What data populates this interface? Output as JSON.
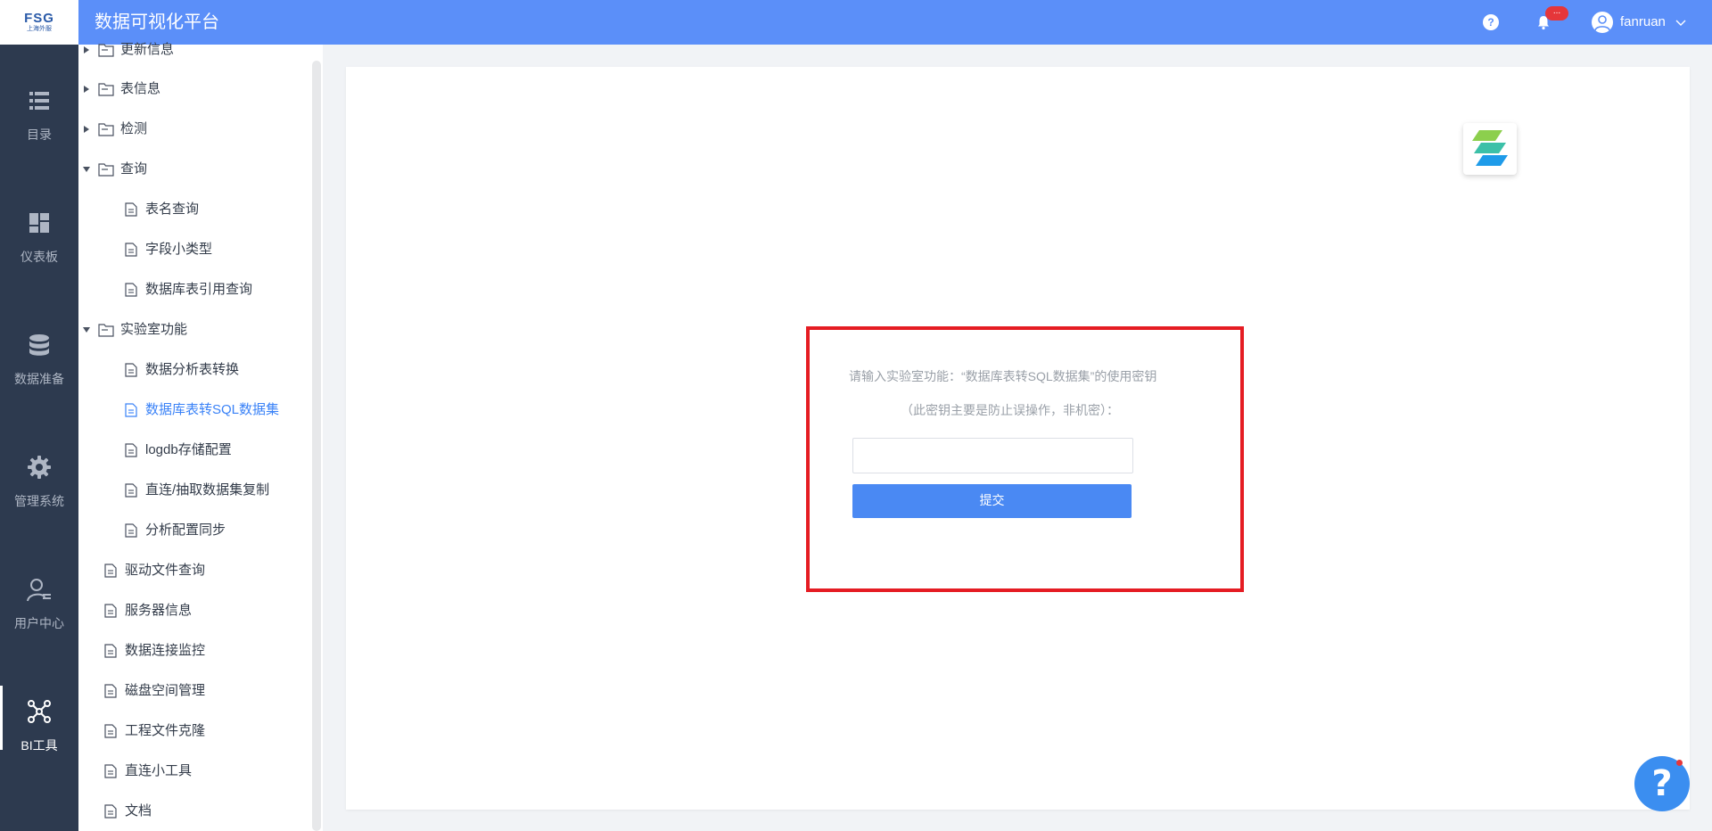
{
  "header": {
    "logo_top": "FSG",
    "logo_bottom": "上海外服",
    "title": "数据可视化平台",
    "help_glyph": "?",
    "notification_badge": "...",
    "username": "fanruan"
  },
  "leftnav": {
    "items": [
      {
        "label": "目录",
        "icon": "list-icon",
        "active": false
      },
      {
        "label": "仪表板",
        "icon": "dashboard-icon",
        "active": false
      },
      {
        "label": "数据准备",
        "icon": "database-icon",
        "active": false
      },
      {
        "label": "管理系统",
        "icon": "gear-icon",
        "active": false
      },
      {
        "label": "用户中心",
        "icon": "user-icon",
        "active": false
      },
      {
        "label": "BI工具",
        "icon": "network-icon",
        "active": true
      }
    ]
  },
  "tree": {
    "items": [
      {
        "label": "更新信息",
        "type": "folder",
        "state": "collapsed"
      },
      {
        "label": "表信息",
        "type": "folder",
        "state": "collapsed"
      },
      {
        "label": "检测",
        "type": "folder",
        "state": "collapsed"
      },
      {
        "label": "查询",
        "type": "folder",
        "state": "expanded"
      },
      {
        "label": "表名查询",
        "type": "file"
      },
      {
        "label": "字段小类型",
        "type": "file"
      },
      {
        "label": "数据库表引用查询",
        "type": "file"
      },
      {
        "label": "实验室功能",
        "type": "folder",
        "state": "expanded"
      },
      {
        "label": "数据分析表转换",
        "type": "file"
      },
      {
        "label": "数据库表转SQL数据集",
        "type": "file",
        "selected": true
      },
      {
        "label": "logdb存储配置",
        "type": "file"
      },
      {
        "label": "直连/抽取数据集复制",
        "type": "file"
      },
      {
        "label": "分析配置同步",
        "type": "file"
      },
      {
        "label": "驱动文件查询",
        "type": "file"
      },
      {
        "label": "服务器信息",
        "type": "file"
      },
      {
        "label": "数据连接监控",
        "type": "file"
      },
      {
        "label": "磁盘空间管理",
        "type": "file"
      },
      {
        "label": "工程文件克隆",
        "type": "file"
      },
      {
        "label": "直连小工具",
        "type": "file"
      },
      {
        "label": "文档",
        "type": "file"
      }
    ]
  },
  "dialog": {
    "prompt_line1": "请输入实验室功能：“数据库表转SQL数据集”的使用密钥",
    "prompt_line2": "（此密钥主要是防止误操作，非机密）：",
    "key_value": "",
    "submit_label": "提交"
  },
  "help_fab": "?",
  "colors": {
    "topbar": "#5b8ff9",
    "leftnav": "#2d3a4f",
    "accent": "#4a89f3",
    "highlight_border": "#e51c23"
  }
}
